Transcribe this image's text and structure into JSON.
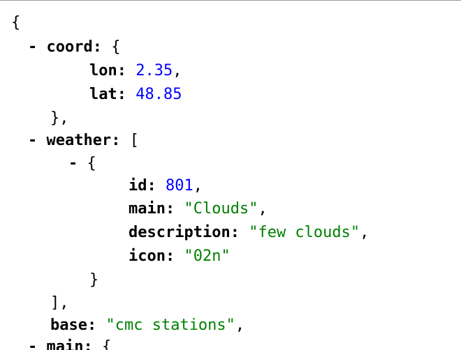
{
  "colors": {
    "number": "#0000ff",
    "string": "#008000",
    "text": "#000000"
  },
  "json": {
    "open_brace": "{",
    "coord": {
      "collapser": "-",
      "key": "coord",
      "colon": ":",
      "open": "{",
      "lon_key": "lon",
      "lon_value": "2.35",
      "lat_key": "lat",
      "lat_value": "48.85",
      "close": "},"
    },
    "weather": {
      "collapser": "-",
      "key": "weather",
      "colon": ":",
      "open": "[",
      "item_collapser": "-",
      "item_open": "{",
      "id_key": "id",
      "id_value": "801",
      "main_key": "main",
      "main_value": "\"Clouds\"",
      "description_key": "description",
      "description_value": "\"few clouds\"",
      "icon_key": "icon",
      "icon_value": "\"02n\"",
      "item_close": "}",
      "close": "],"
    },
    "base": {
      "key": "base",
      "colon": ":",
      "value": "\"cmc stations\""
    },
    "main": {
      "collapser": "-",
      "key": "main",
      "colon": ":",
      "open": "{"
    }
  }
}
